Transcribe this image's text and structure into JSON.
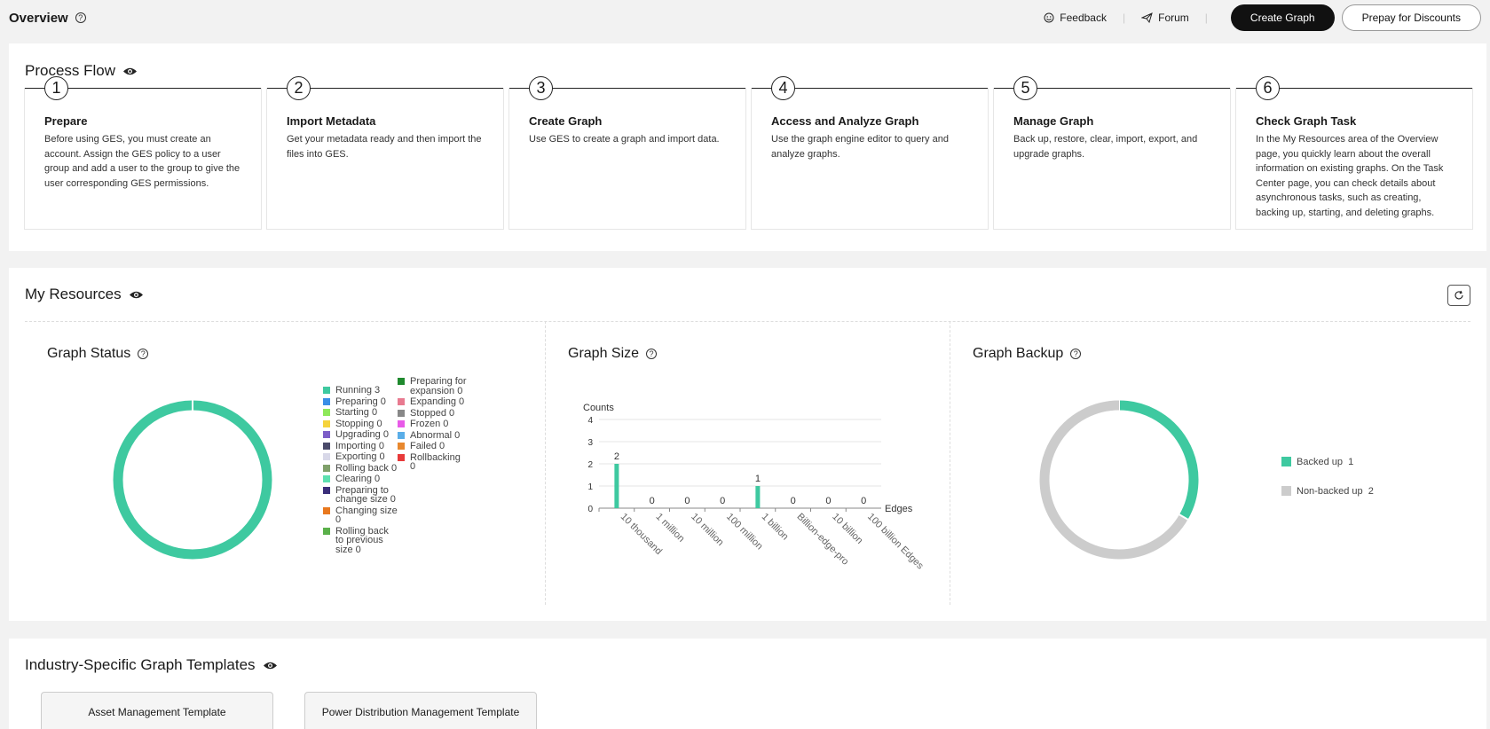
{
  "header": {
    "title": "Overview",
    "feedback_label": "Feedback",
    "forum_label": "Forum",
    "create_graph_label": "Create Graph",
    "prepay_label": "Prepay for Discounts"
  },
  "process_flow": {
    "title": "Process Flow",
    "steps": [
      {
        "num": "1",
        "title": "Prepare",
        "desc": "Before using GES, you must create an account. Assign the GES policy to a user group and add a user to the group to give the user corresponding GES permissions."
      },
      {
        "num": "2",
        "title": "Import Metadata",
        "desc": "Get your metadata ready and then import the files into GES."
      },
      {
        "num": "3",
        "title": "Create Graph",
        "desc": "Use GES to create a graph and import data."
      },
      {
        "num": "4",
        "title": "Access and Analyze Graph",
        "desc": "Use the graph engine editor to query and analyze graphs."
      },
      {
        "num": "5",
        "title": "Manage Graph",
        "desc": "Back up, restore, clear, import, export, and upgrade graphs."
      },
      {
        "num": "6",
        "title": "Check Graph Task",
        "desc": "In the My Resources area of the Overview page, you quickly learn about the overall information on existing graphs. On the Task Center page, you can check details about asynchronous tasks, such as creating, backing up, starting, and deleting graphs."
      }
    ]
  },
  "resources": {
    "title": "My Resources",
    "graph_status_title": "Graph Status",
    "graph_size_title": "Graph Size",
    "graph_backup_title": "Graph Backup"
  },
  "templates": {
    "title": "Industry-Specific Graph Templates",
    "items": [
      "Asset Management Template",
      "Power Distribution Management Template"
    ]
  },
  "chart_data": [
    {
      "type": "pie",
      "title": "Graph Status",
      "legend_col1": [
        {
          "label": "Running 3",
          "color": "#3ec9a0",
          "value": 3
        },
        {
          "label": "Preparing  0",
          "color": "#3a8ee6",
          "value": 0
        },
        {
          "label": "Starting  0",
          "color": "#8ee85a",
          "value": 0
        },
        {
          "label": "Stopping 0",
          "color": "#f5d33c",
          "value": 0
        },
        {
          "label": "Upgrading 0",
          "color": "#7d5fc8",
          "value": 0
        },
        {
          "label": "Importing  0",
          "color": "#4a4a6a",
          "value": 0
        },
        {
          "label": "Exporting  0",
          "color": "#d8d8e8",
          "value": 0
        },
        {
          "label": "Rolling back 0",
          "color": "#7fa06a",
          "value": 0
        },
        {
          "label": "Clearing  0",
          "color": "#5ee0b0",
          "value": 0
        },
        {
          "label": "Preparing to change size 0",
          "color": "#3b2f7a",
          "value": 0
        },
        {
          "label": "Changing size 0",
          "color": "#e8781e",
          "value": 0
        },
        {
          "label": "Rolling back to previous size 0",
          "color": "#5ab04a",
          "value": 0
        }
      ],
      "legend_col2": [
        {
          "label": "Preparing for expansion  0",
          "color": "#1f8a2e",
          "value": 0
        },
        {
          "label": "Expanding  0",
          "color": "#e87a90",
          "value": 0
        },
        {
          "label": "Stopped 0",
          "color": "#888888",
          "value": 0
        },
        {
          "label": "Frozen 0",
          "color": "#e85ae8",
          "value": 0
        },
        {
          "label": "Abnormal 0",
          "color": "#5aaee8",
          "value": 0
        },
        {
          "label": "Failed 0",
          "color": "#e8882e",
          "value": 0
        },
        {
          "label": "Rollbacking 0",
          "color": "#e83a3a",
          "value": 0
        }
      ]
    },
    {
      "type": "bar",
      "title": "Graph Size",
      "ylabel": "Counts",
      "xlabel": "Edges",
      "ylim": [
        0,
        4
      ],
      "yticks": [
        0,
        1,
        2,
        3,
        4
      ],
      "categories": [
        "10 thousand",
        "1 million",
        "10 million",
        "100 million",
        "1 billion",
        "Billion-edge-pro",
        "10 billion",
        "100 billion Edges"
      ],
      "values": [
        2,
        0,
        0,
        0,
        1,
        0,
        0,
        0
      ],
      "bar_color": "#3ec9a0"
    },
    {
      "type": "pie",
      "title": "Graph Backup",
      "slices": [
        {
          "label": "Backed up",
          "value": 1,
          "color": "#3ec9a0"
        },
        {
          "label": "Non-backed up",
          "value": 2,
          "color": "#cccccc"
        }
      ]
    }
  ]
}
